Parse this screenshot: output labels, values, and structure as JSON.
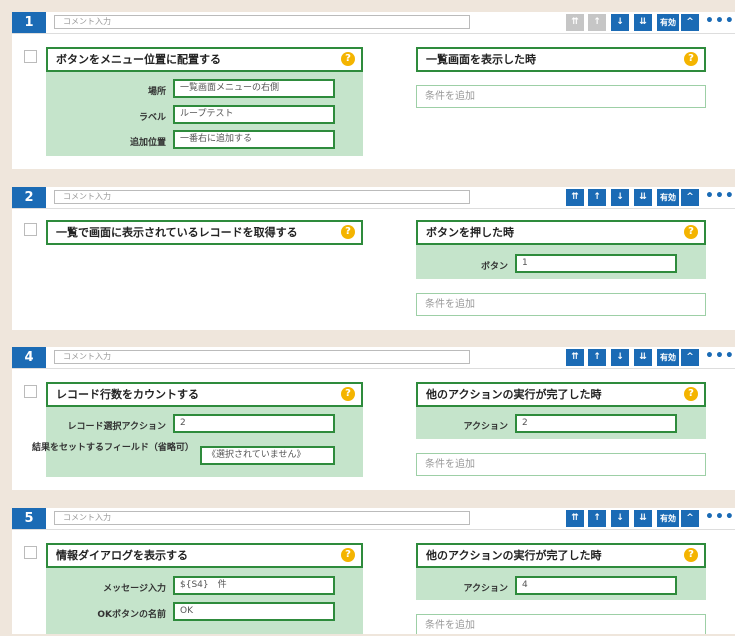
{
  "header_controls": {
    "move_top": "⇈",
    "move_up": "↑",
    "move_down": "↓",
    "move_bottom": "⇊",
    "enabled": "有効",
    "collapse": "^",
    "more": "•••"
  },
  "help_glyph": "?",
  "comment_placeholder": "コメント入力",
  "condition_placeholder": "条件を追加",
  "icons": {
    "help": "question-circle-icon",
    "checkbox": "checkbox-icon"
  },
  "colors": {
    "accent": "#1b6bb5",
    "panel_green": "#c5e4cb",
    "border_green": "#2e8b3c",
    "help": "#f4b400"
  },
  "blocks": [
    {
      "number": "1",
      "action": {
        "title": "ボタンをメニュー位置に配置する",
        "fields": [
          {
            "label": "場所",
            "value": "一覧画面メニューの右側"
          },
          {
            "label": "ラベル",
            "value": "ループテスト"
          },
          {
            "label": "追加位置",
            "value": "一番右に追加する"
          }
        ]
      },
      "trigger": {
        "title": "一覧画面を表示した時",
        "fields": []
      }
    },
    {
      "number": "2",
      "action": {
        "title": "一覧で画面に表示されているレコードを取得する",
        "fields": []
      },
      "trigger": {
        "title": "ボタンを押した時",
        "fields": [
          {
            "label": "ボタン",
            "value": "1"
          }
        ]
      }
    },
    {
      "number": "4",
      "action": {
        "title": "レコード行数をカウントする",
        "fields": [
          {
            "label": "レコード選択アクション",
            "value": "2"
          },
          {
            "label": "結果をセットするフィールド（省略可）",
            "value": "《選択されていません》"
          }
        ]
      },
      "trigger": {
        "title": "他のアクションの実行が完了した時",
        "fields": [
          {
            "label": "アクション",
            "value": "2"
          }
        ]
      }
    },
    {
      "number": "5",
      "action": {
        "title": "情報ダイアログを表示する",
        "fields": [
          {
            "label": "メッセージ入力",
            "value": "${S4}　件"
          },
          {
            "label": "OKボタンの名前",
            "value": "OK"
          }
        ]
      },
      "trigger": {
        "title": "他のアクションの実行が完了した時",
        "fields": [
          {
            "label": "アクション",
            "value": "4"
          }
        ]
      }
    }
  ]
}
